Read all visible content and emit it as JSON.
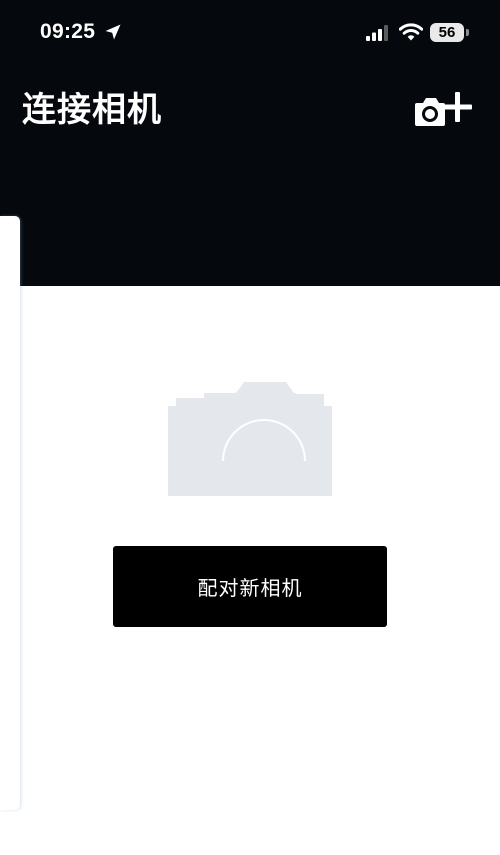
{
  "status_bar": {
    "time": "09:25",
    "battery_level": "56"
  },
  "header": {
    "title": "连接相机"
  },
  "main": {
    "pair_button_label": "配对新相机"
  },
  "colors": {
    "header_background": "#05080c",
    "illustration_gray": "#e4e8ed"
  },
  "icons": {
    "location": "location-arrow-icon",
    "signal": "cellular-signal-icon",
    "wifi": "wifi-icon",
    "add_camera": "camera-plus-icon",
    "placeholder": "camera-placeholder-icon"
  }
}
